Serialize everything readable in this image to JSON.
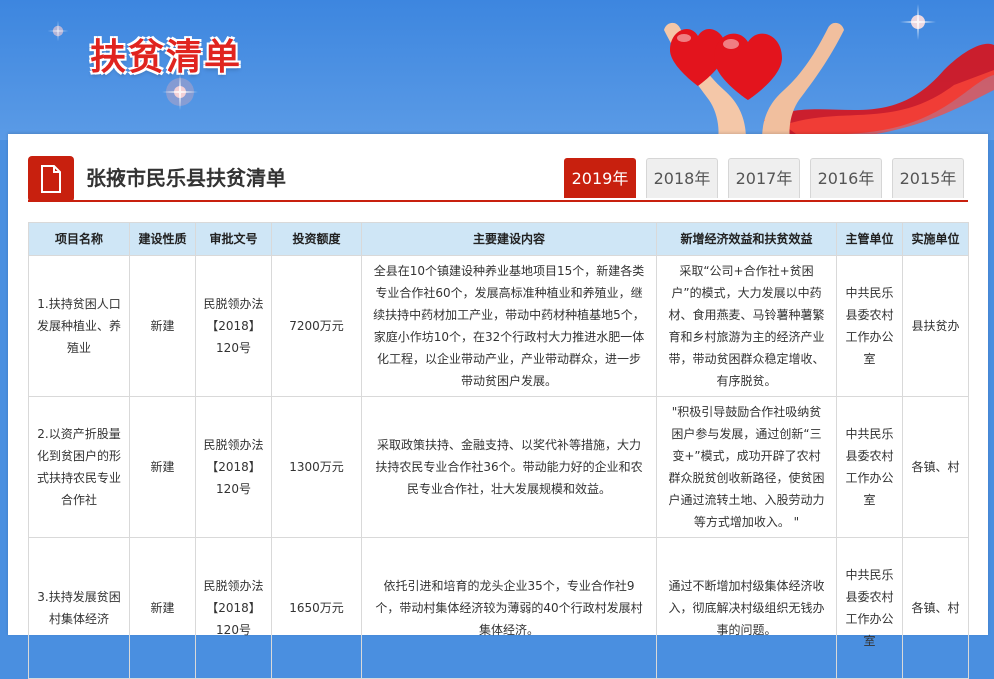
{
  "banner": {
    "title": "扶贫清单"
  },
  "header": {
    "title": "张掖市民乐县扶贫清单"
  },
  "colors": {
    "accent": "#c8200e",
    "header_bg": "#cfe6f6",
    "banner_bg": "#4a8fe0"
  },
  "year_tabs": [
    "2019年",
    "2018年",
    "2017年",
    "2016年",
    "2015年"
  ],
  "active_year": "2019年",
  "table": {
    "headers": [
      "项目名称",
      "建设性质",
      "审批文号",
      "投资额度",
      "主要建设内容",
      "新增经济效益和扶贫效益",
      "主管单位",
      "实施单位"
    ],
    "rows": [
      {
        "name": "1.扶持贫困人口发展种植业、养殖业",
        "nature": "新建",
        "approval": "民脱领办法【2018】120号",
        "amount": "7200万元",
        "content": "全县在10个镇建设种养业基地项目15个，新建各类专业合作社60个，发展高标准种植业和养殖业，继续扶持中药材加工产业，带动中药材种植基地5个，家庭小作坊10个，在32个行政村大力推进水肥一体化工程，以企业带动产业，产业带动群众，进一步带动贫困户发展。",
        "benefit": "采取“公司+合作社+贫困户”的模式，大力发展以中药材、食用燕麦、马铃薯种薯繁育和乡村旅游为主的经济产业带，带动贫困群众稳定增收、有序脱贫。",
        "supervisor": "中共民乐县委农村工作办公室",
        "implementer": "县扶贫办"
      },
      {
        "name": "2.以资产折股量化到贫困户的形式扶持农民专业合作社",
        "nature": "新建",
        "approval": "民脱领办法【2018】120号",
        "amount": "1300万元",
        "content": "采取政策扶持、金融支持、以奖代补等措施，大力扶持农民专业合作社36个。带动能力好的企业和农民专业合作社，壮大发展规模和效益。",
        "benefit": "\"积极引导鼓励合作社吸纳贫困户参与发展，通过创新“三变+”模式，成功开辟了农村群众脱贫创收新路径，使贫困户通过流转土地、入股劳动力等方式增加收入。 \"",
        "supervisor": "中共民乐县委农村工作办公室",
        "implementer": "各镇、村"
      },
      {
        "name": "3.扶持发展贫困村集体经济",
        "nature": "新建",
        "approval": "民脱领办法【2018】120号",
        "amount": "1650万元",
        "content": "依托引进和培育的龙头企业35个，专业合作社9个，带动村集体经济较为薄弱的40个行政村发展村集体经济。",
        "benefit": "通过不断增加村级集体经济收入，彻底解决村级组织无钱办事的问题。",
        "supervisor": "中共民乐县委农村工作办公室",
        "implementer": "各镇、村"
      }
    ]
  }
}
